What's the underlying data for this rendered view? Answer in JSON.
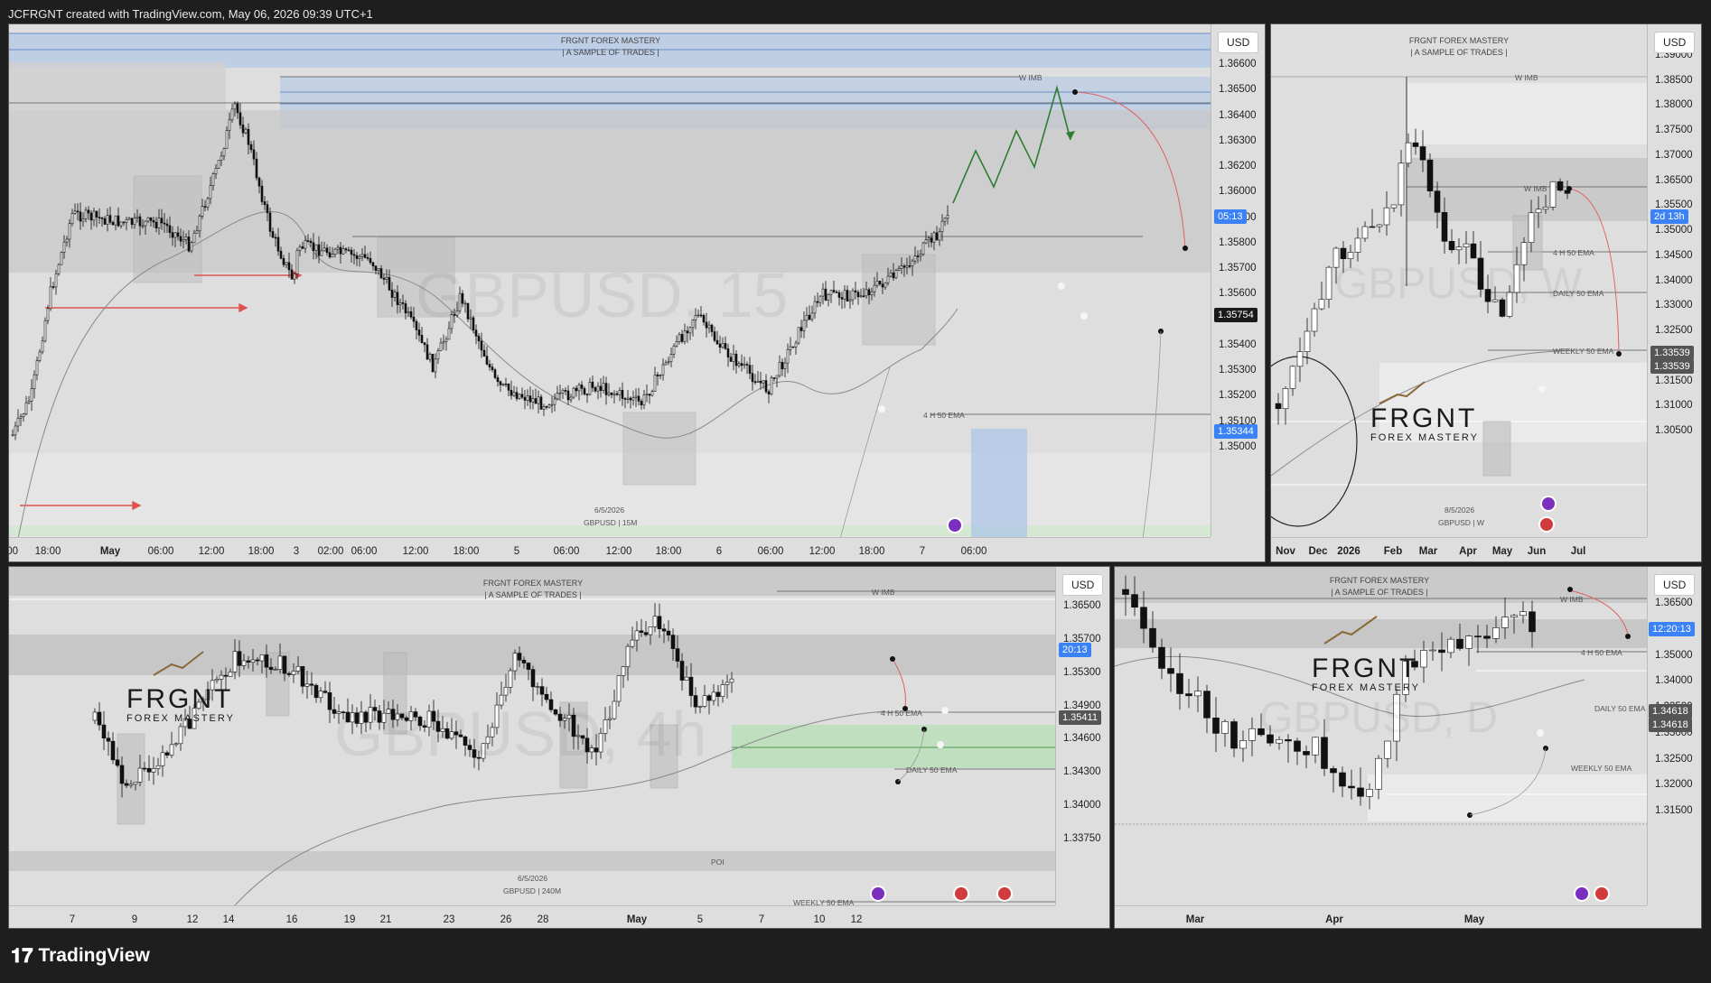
{
  "header": {
    "text": "JCFRGNT created with TradingView.com, May 06, 2026 09:39 UTC+1"
  },
  "footer": {
    "brand": "TradingView"
  },
  "colors": {
    "bg": "#1e1e1e",
    "panel": "#dedede",
    "blue_tag": "#3b82f6",
    "zone_blue": "#a9c3e8",
    "zone_green": "#b7dfb7",
    "arrow_red": "#e05252",
    "path_green": "#2f7d32"
  },
  "panels": [
    {
      "id": "m15",
      "currency": "USD",
      "brand_title": "FRGNT FOREX MASTERY",
      "brand_sub": "| A SAMPLE OF TRADES |",
      "watermark": "GBPUSD, 15",
      "footer_date": "6/5/2026",
      "footer_symbol": "GBPUSD | 15M",
      "labels": {
        "wimb": "W IMB",
        "ema": "4 H 50 EMA"
      },
      "price_labels": [
        "1.36600",
        "1.36500",
        "1.36400",
        "1.36300",
        "1.36200",
        "1.36000",
        "1.35900",
        "1.35800",
        "1.35700",
        "1.35600",
        "1.35500",
        "1.35400",
        "1.35300",
        "1.35200",
        "1.35100",
        "1.35000"
      ],
      "price_partial": "0",
      "tags": {
        "countdown": "05:13",
        "last": "1.35754",
        "ema": "1.35344"
      },
      "time_labels": [
        ":00",
        "18:00",
        "May",
        "06:00",
        "12:00",
        "18:00",
        "3",
        "02:00",
        "06:00",
        "12:00",
        "18:00",
        "5",
        "06:00",
        "12:00",
        "18:00",
        "6",
        "06:00",
        "12:00",
        "18:00",
        "7",
        "06:00"
      ]
    },
    {
      "id": "weekly",
      "currency": "USD",
      "brand_title": "FRGNT FOREX MASTERY",
      "brand_sub": "| A SAMPLE OF TRADES |",
      "watermark": "GBPUSD, W",
      "footer_date": "8/5/2026",
      "footer_symbol": "GBPUSD | W",
      "logo_big": "FRGNT",
      "logo_sub": "FOREX MASTERY",
      "labels": {
        "wimb": "W IMB",
        "wimb2": "W IMB",
        "h4ema": "4 H 50 EMA",
        "dema": "DAILY 50 EMA",
        "wema": "WEEKLY 50 EMA"
      },
      "price_labels": [
        "1.39000",
        "1.38500",
        "1.38000",
        "1.37500",
        "1.37000",
        "1.36500",
        "1.35500",
        "1.35000",
        "1.34500",
        "1.34000",
        "1.33000",
        "1.32500",
        "1.32000",
        "1.31500",
        "1.31000",
        "1.30500"
      ],
      "tags": {
        "countdown": "2d 13h",
        "last1": "1.33539",
        "last2": "1.33539"
      },
      "time_labels": [
        "Nov",
        "Dec",
        "2026",
        "Feb",
        "Mar",
        "Apr",
        "May",
        "Jun",
        "Jul"
      ]
    },
    {
      "id": "h4",
      "currency": "USD",
      "brand_title": "FRGNT FOREX MASTERY",
      "brand_sub": "| A SAMPLE OF TRADES |",
      "watermark": "GBPUSD, 4h",
      "footer_date": "6/5/2026",
      "footer_symbol": "GBPUSD | 240M",
      "logo_big": "FRGNT",
      "logo_sub": "FOREX MASTERY",
      "labels": {
        "wimb": "W IMB",
        "h4ema": "4 H 50 EMA",
        "dema": "DAILY 50 EMA",
        "poi": "POI",
        "wema": "WEEKLY 50 EMA"
      },
      "price_labels": [
        "1.36500",
        "1.35700",
        "1.35300",
        "1.34900",
        "1.34600",
        "1.34300",
        "1.34000",
        "1.33750"
      ],
      "price_partial": "0",
      "tags": {
        "countdown": "20:13",
        "last": "1.35411"
      },
      "time_labels": [
        "7",
        "9",
        "12",
        "14",
        "16",
        "19",
        "21",
        "23",
        "26",
        "28",
        "May",
        "5",
        "7",
        "10",
        "12"
      ]
    },
    {
      "id": "daily",
      "currency": "USD",
      "brand_title": "FRGNT FOREX MASTERY",
      "brand_sub": "| A SAMPLE OF TRADES |",
      "watermark": "GBPUSD, D",
      "logo_big": "FRGNT",
      "logo_sub": "FOREX MASTERY",
      "labels": {
        "wimb": "W IMB",
        "h4ema": "4 H 50 EMA",
        "dema": "DAILY 50 EMA",
        "wema": "WEEKLY 50 EMA"
      },
      "price_labels": [
        "1.36500",
        "1.35500",
        "1.35000",
        "1.34000",
        "1.33500",
        "1.33000",
        "1.32500",
        "1.32000",
        "1.31500"
      ],
      "price_partial": "0",
      "tags": {
        "countdown": "12:20:13",
        "last1": "1.34618",
        "last2": "1.34618"
      },
      "time_labels": [
        "Mar",
        "Apr",
        "May"
      ]
    }
  ]
}
